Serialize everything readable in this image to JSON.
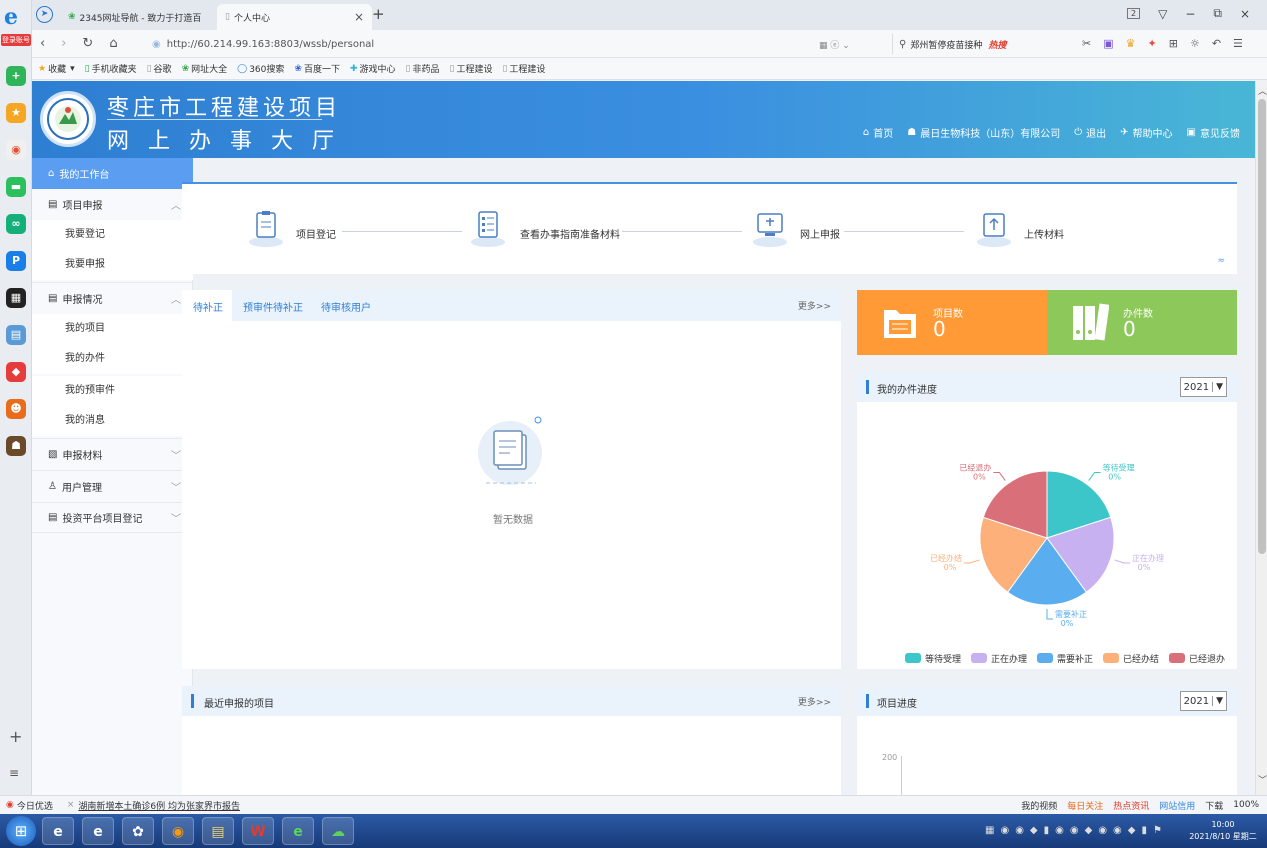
{
  "browser": {
    "tabs": [
      {
        "label": "2345网址导航 - 致力于打造百"
      },
      {
        "label": "个人中心"
      }
    ],
    "close_tab": "×",
    "new_tab": "+",
    "window_controls": [
      "2",
      "▽",
      "−",
      "⧉",
      "×"
    ],
    "url": "http://60.214.99.163:8803/wssb/personal",
    "search_placeholder": "郑州暂停疫苗接种",
    "hot": "热搜",
    "favorites": [
      "收藏",
      "手机收藏夹",
      "谷歌",
      "网址大全",
      "360搜索",
      "百度一下",
      "游戏中心",
      "非药品",
      "工程建设",
      "工程建设"
    ],
    "rail_login": "登录账号"
  },
  "site": {
    "title_line1": "枣庄市工程建设项目",
    "title_line2": "网 上 办 事 大 厅",
    "nav": [
      "首页",
      "晨日生物科技（山东）有限公司",
      "退出",
      "帮助中心",
      "意见反馈"
    ]
  },
  "sidebar": {
    "workbench": "我的工作台",
    "groups": [
      {
        "label": "项目申报",
        "items": [
          "我要登记",
          "我要申报"
        ]
      },
      {
        "label": "申报情况",
        "items": [
          "我的项目",
          "我的办件",
          "我的预审件",
          "我的消息"
        ]
      },
      {
        "label": "申报材料",
        "items": []
      },
      {
        "label": "用户管理",
        "items": []
      },
      {
        "label": "投资平台项目登记",
        "items": []
      }
    ]
  },
  "steps": [
    "项目登记",
    "查看办事指南准备材料",
    "网上申报",
    "上传材料"
  ],
  "tasks": {
    "tabs": [
      "待补正",
      "预审件待补正",
      "待审核用户"
    ],
    "more": "更多>>",
    "empty": "暂无数据"
  },
  "stats": {
    "project_label": "项目数",
    "project_value": "0",
    "case_label": "办件数",
    "case_value": "0"
  },
  "progress": {
    "title": "我的办件进度",
    "year": "2021"
  },
  "recent": {
    "title": "最近申报的项目",
    "more": "更多>>"
  },
  "project_progress": {
    "title": "项目进度",
    "year": "2021",
    "y_tick": "200"
  },
  "chart_data": {
    "type": "pie",
    "categories": [
      "等待受理",
      "正在办理",
      "需要补正",
      "已经办结",
      "已经退办"
    ],
    "values": [
      0,
      0,
      0,
      0,
      0
    ],
    "value_labels": [
      "0%",
      "0%",
      "0%",
      "0%",
      "0%"
    ],
    "colors": [
      "#3cc6c9",
      "#c7b1f0",
      "#5aaeef",
      "#fdb07a",
      "#d96f78"
    ],
    "legend": "bottom"
  },
  "status": {
    "left": "今日优选",
    "news": "湖南新増本土确诊6例 均为张家界市报告",
    "right": [
      "我的视频",
      "每日关注",
      "热点资讯",
      "网站信用",
      "下载",
      "100%"
    ]
  },
  "taskbar": {
    "time": "10:00",
    "date": "2021/8/10 星期二"
  }
}
